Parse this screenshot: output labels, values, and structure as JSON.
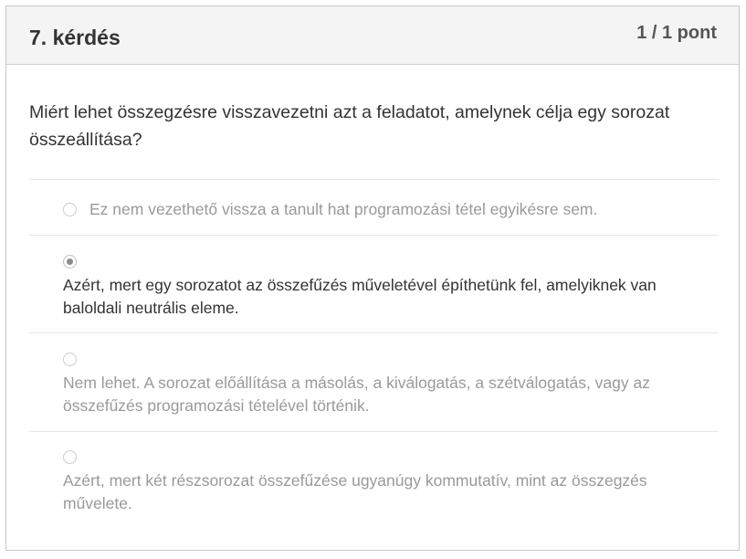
{
  "question": {
    "number_label": "7. kérdés",
    "points_label": "1 / 1 pont",
    "text": "Miért lehet összegzésre visszavezetni azt a feladatot, amelynek célja egy sorozat összeállítása?"
  },
  "options": [
    {
      "text": "Ez nem vezethető vissza a tanult hat programozási tétel egyikésre sem.",
      "selected": false
    },
    {
      "text": "Azért, mert egy sorozatot az összefűzés műveletével építhetünk fel, amelyiknek van baloldali neutrális eleme.",
      "selected": true
    },
    {
      "text": "Nem lehet. A sorozat előállítása a másolás, a kiválogatás, a szétválogatás, vagy az összefűzés programozási tételével történik.",
      "selected": false
    },
    {
      "text": "Azért, mert két részsorozat összefűzése ugyanúgy kommutatív, mint az összegzés művelete.",
      "selected": false
    }
  ],
  "colors": {
    "header_bg": "#f4f4f4",
    "selected_text": "#333333",
    "unselected_text": "#9a9a9a",
    "radio_fill": "#8a8a8a"
  }
}
